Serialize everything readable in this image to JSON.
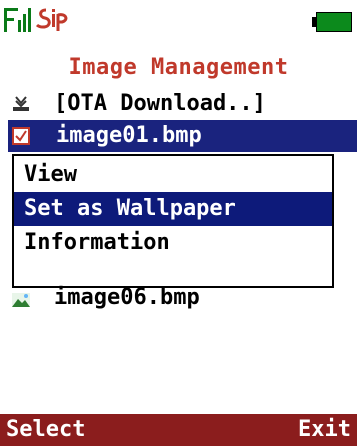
{
  "status": {
    "sip_label": "SIP",
    "battery_color": "#0c8a1c"
  },
  "title": "Image Management",
  "list": {
    "items": [
      {
        "label": "[OTA Download..]",
        "icon": "download-icon",
        "selected": false
      },
      {
        "label": "image01.bmp",
        "icon": "checkbox-checked-icon",
        "selected": true
      },
      {
        "label": "image06.bmp",
        "icon": "image-icon",
        "selected": false
      }
    ]
  },
  "menu": {
    "items": [
      {
        "label": "View",
        "selected": false
      },
      {
        "label": "Set as Wallpaper",
        "selected": true
      },
      {
        "label": "Information",
        "selected": false
      }
    ]
  },
  "softkeys": {
    "left": "Select",
    "right": "Exit",
    "bar_color": "#8b1d1d"
  },
  "colors": {
    "title": "#c0392b",
    "selection": "#1a237e"
  }
}
